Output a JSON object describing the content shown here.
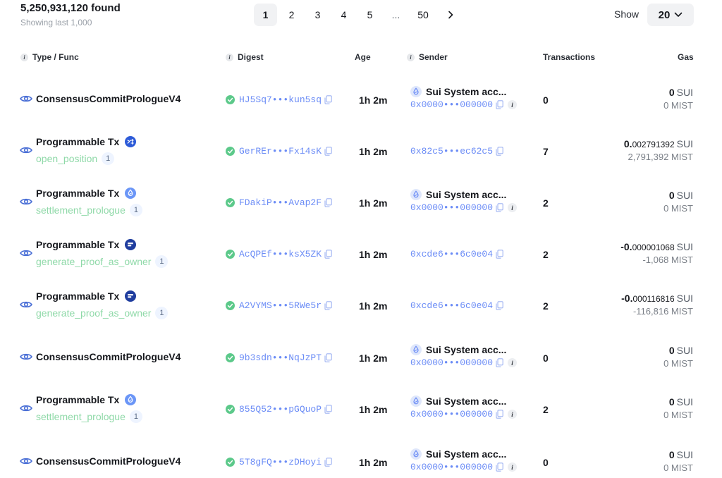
{
  "header": {
    "count": "5,250,931,120 found",
    "subtitle": "Showing last 1,000",
    "show_label": "Show",
    "page_size": "20"
  },
  "pagination": {
    "pages": [
      "1",
      "2",
      "3",
      "4",
      "5",
      "...",
      "50"
    ],
    "active": "1",
    "next_icon": "chevron-right-icon"
  },
  "columns": {
    "type": "Type / Func",
    "digest": "Digest",
    "age": "Age",
    "sender": "Sender",
    "transactions": "Transactions",
    "gas": "Gas"
  },
  "colors": {
    "accent": "#6b8cf6",
    "func_green": "#8fd9a8",
    "success": "#5cc98a"
  },
  "rows": [
    {
      "type": "ConsensusCommitPrologueV4",
      "func": "",
      "func_count": "",
      "badge": "",
      "digest": "HJ5Sq7•••kun5sq",
      "age": "1h 2m",
      "sender_name": "Sui System acc...",
      "sender_addr": "0x0000•••000000",
      "transactions": "0",
      "gas_int": "0",
      "gas_frac": "",
      "gas_unit": "SUI",
      "mist": "0 MIST"
    },
    {
      "type": "Programmable Tx",
      "func": "open_position",
      "func_count": "1",
      "badge": "swap-icon",
      "digest": "GerREr•••Fx14sK",
      "age": "1h 2m",
      "sender_name": "",
      "sender_addr": "0x82c5•••ec62c5",
      "transactions": "7",
      "gas_int": "0.",
      "gas_frac": "002791392",
      "gas_unit": "SUI",
      "mist": "2,791,392 MIST"
    },
    {
      "type": "Programmable Tx",
      "func": "settlement_prologue",
      "func_count": "1",
      "badge": "sui-drop-icon",
      "digest": "FDakiP•••Avap2F",
      "age": "1h 2m",
      "sender_name": "Sui System acc...",
      "sender_addr": "0x0000•••000000",
      "transactions": "2",
      "gas_int": "0",
      "gas_frac": "",
      "gas_unit": "SUI",
      "mist": "0 MIST"
    },
    {
      "type": "Programmable Tx",
      "func": "generate_proof_as_owner",
      "func_count": "1",
      "badge": "card-icon",
      "digest": "AcQPEf•••ksX5ZK",
      "age": "1h 2m",
      "sender_name": "",
      "sender_addr": "0xcde6•••6c0e04",
      "transactions": "2",
      "gas_int": "-0.",
      "gas_frac": "000001068",
      "gas_unit": "SUI",
      "mist": "-1,068 MIST"
    },
    {
      "type": "Programmable Tx",
      "func": "generate_proof_as_owner",
      "func_count": "1",
      "badge": "card-icon",
      "digest": "A2VYMS•••5RWe5r",
      "age": "1h 2m",
      "sender_name": "",
      "sender_addr": "0xcde6•••6c0e04",
      "transactions": "2",
      "gas_int": "-0.",
      "gas_frac": "000116816",
      "gas_unit": "SUI",
      "mist": "-116,816 MIST"
    },
    {
      "type": "ConsensusCommitPrologueV4",
      "func": "",
      "func_count": "",
      "badge": "",
      "digest": "9b3sdn•••NqJzPT",
      "age": "1h 2m",
      "sender_name": "Sui System acc...",
      "sender_addr": "0x0000•••000000",
      "transactions": "0",
      "gas_int": "0",
      "gas_frac": "",
      "gas_unit": "SUI",
      "mist": "0 MIST"
    },
    {
      "type": "Programmable Tx",
      "func": "settlement_prologue",
      "func_count": "1",
      "badge": "sui-drop-icon",
      "digest": "855Q52•••pGQuoP",
      "age": "1h 2m",
      "sender_name": "Sui System acc...",
      "sender_addr": "0x0000•••000000",
      "transactions": "2",
      "gas_int": "0",
      "gas_frac": "",
      "gas_unit": "SUI",
      "mist": "0 MIST"
    },
    {
      "type": "ConsensusCommitPrologueV4",
      "func": "",
      "func_count": "",
      "badge": "",
      "digest": "5T8gFQ•••zDHoyi",
      "age": "1h 2m",
      "sender_name": "Sui System acc...",
      "sender_addr": "0x0000•••000000",
      "transactions": "0",
      "gas_int": "0",
      "gas_frac": "",
      "gas_unit": "SUI",
      "mist": "0 MIST"
    }
  ]
}
